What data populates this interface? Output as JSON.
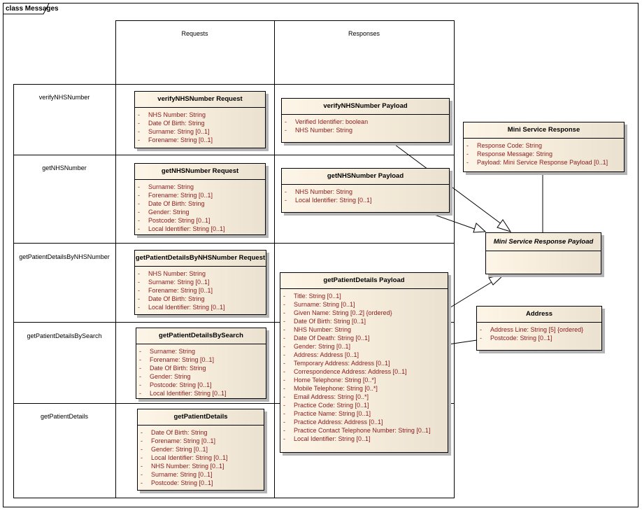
{
  "diagram": {
    "frame_label": "class Messages",
    "columns": [
      "Requests",
      "Responses"
    ],
    "rows": [
      "verifyNHSNumber",
      "getNHSNumber",
      "getPatientDetailsByNHSNumber",
      "getPatientDetailsBySearch",
      "getPatientDetails"
    ],
    "requests": [
      {
        "title": "verifyNHSNumber Request",
        "attributes": [
          "NHS Number:  String",
          "Date Of Birth:  String",
          "Surname:  String [0..1]",
          "Forename:  String [0..1]"
        ]
      },
      {
        "title": "getNHSNumber Request",
        "attributes": [
          "Surname:  String",
          "Forename:  String [0..1]",
          "Date Of Birth:  String",
          "Gender:  String",
          "Postcode:  String  [0..1]",
          "Local Identifier:  String [0..1]"
        ]
      },
      {
        "title": "getPatientDetailsByNHSNumber Request",
        "attributes": [
          "NHS Number:  String",
          "Surname:  String [0..1]",
          "Forename:  String [0..1]",
          "Date Of Birth:  String",
          "Local Identifier:  String [0..1]"
        ]
      },
      {
        "title": "getPatientDetailsBySearch",
        "attributes": [
          "Surname:  String",
          "Forename:  String [0..1]",
          "Date Of Birth:  String",
          "Gender:  String",
          "Postcode:  String [0..1]",
          "Local Identifier:  String [0..1]"
        ]
      },
      {
        "title": "getPatientDetails",
        "attributes": [
          "Date Of Birth:  String",
          "Forename:  String [0..1]",
          "Gender:  String [0..1]",
          "Local Identifier:  String [0..1]",
          "NHS Number:  String [0..1]",
          "Surname:  String [0..1]",
          "Postcode:  String [0..1]"
        ]
      }
    ],
    "responses": [
      {
        "title": "verifyNHSNumber Payload",
        "attributes": [
          "Verified Identifier:  boolean",
          "NHS Number:  String"
        ]
      },
      {
        "title": "getNHSNumber Payload",
        "attributes": [
          "NHS Number:  String",
          "Local Identifier:  String [0..1]"
        ]
      },
      {
        "title": "getPatientDetails Payload",
        "attributes": [
          "Title:  String [0..1]",
          "Surname:  String [0..1]",
          "Given Name:  String [0..2] {ordered}",
          "Date Of Birth:  String [0..1]",
          "NHS Number:  String",
          "Date Of Death:  String [0..1]",
          "Gender:  String [0..1]",
          "Address:  Address [0..1]",
          "Temporary Address:  Address [0..1]",
          "Correspondence Address:  Address [0..1]",
          "Home Telephone:  String [0..*]",
          "Mobile Telephone:  String [0..*]",
          "Email Address:  String [0..*]",
          "Practice Code:  String [0..1]",
          "Practice Name:  String [0..1]",
          "Practice Address:  Address [0..1]",
          "Practice Contact Telephone Number:  String [0..1]",
          "Local Identifier:  String [0..1]"
        ]
      }
    ],
    "mini_service_response": {
      "title": "Mini Service Response",
      "attributes": [
        "Response Code:  String",
        "Response Message:  String",
        "Payload:  Mini Service Response Payload [0..1]"
      ]
    },
    "mini_service_response_payload": {
      "title": "Mini Service Response Payload",
      "attributes": []
    },
    "address": {
      "title": "Address",
      "attributes": [
        "Address Line:  String [5] {ordered}",
        "Postcode:  String [0..1]"
      ]
    },
    "attribute_visibility": "-",
    "relationships": [
      {
        "from": "verifyNHSNumber Payload",
        "to": "Mini Service Response Payload",
        "type": "generalization"
      },
      {
        "from": "getNHSNumber Payload",
        "to": "Mini Service Response Payload",
        "type": "generalization"
      },
      {
        "from": "getPatientDetails Payload",
        "to": "Mini Service Response Payload",
        "type": "generalization"
      },
      {
        "from": "Mini Service Response",
        "to": "Mini Service Response Payload",
        "type": "association"
      },
      {
        "from": "getPatientDetails Payload",
        "to": "Address",
        "type": "association"
      }
    ],
    "colors": {
      "attribute_text": "#8a1a1a",
      "class_fill": "#f7eddc",
      "line": "#000000"
    }
  }
}
